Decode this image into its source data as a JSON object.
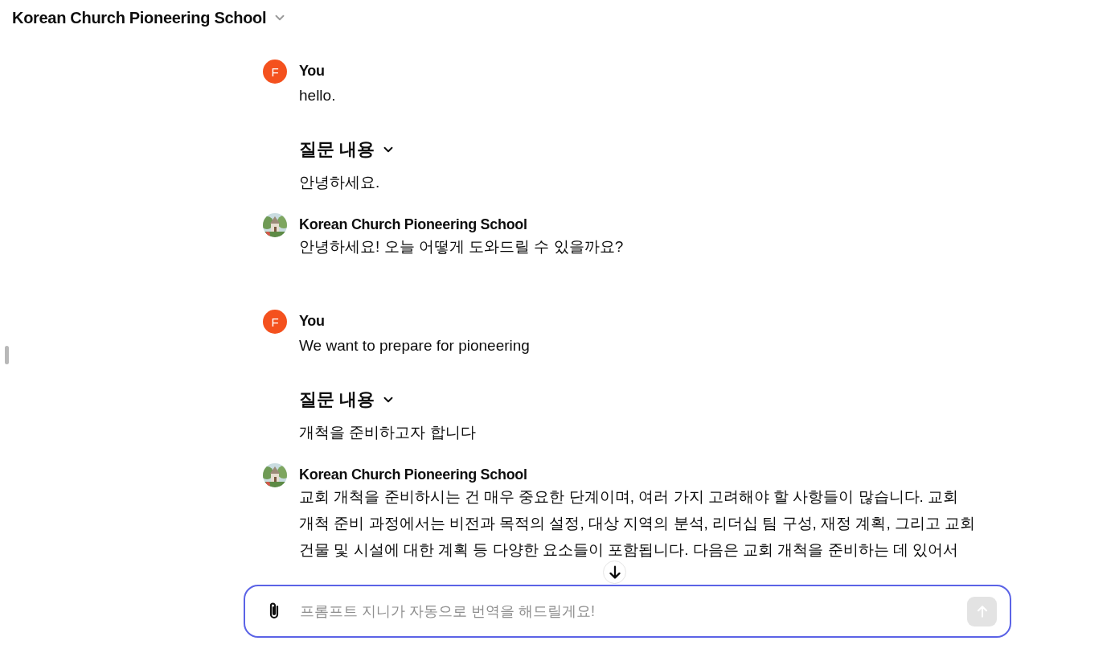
{
  "header": {
    "title": "Korean Church Pioneering School"
  },
  "messages": [
    {
      "kind": "user",
      "avatar_letter": "F",
      "author": "You",
      "text": "hello."
    },
    {
      "kind": "translation",
      "heading": "질문 내용",
      "text": "안녕하세요."
    },
    {
      "kind": "bot",
      "author": "Korean Church Pioneering School",
      "text": "안녕하세요! 오늘 어떻게 도와드릴 수 있을까요?"
    },
    {
      "kind": "user",
      "avatar_letter": "F",
      "author": "You",
      "text": "We want to prepare for pioneering"
    },
    {
      "kind": "translation",
      "heading": "질문 내용",
      "text": "개척을 준비하고자 합니다"
    },
    {
      "kind": "bot",
      "author": "Korean Church Pioneering School",
      "text": "교회 개척을 준비하시는 건 매우 중요한 단계이며, 여러 가지 고려해야 할 사항들이 많습니다. 교회 개척 준비 과정에서는 비전과 목적의 설정, 대상 지역의 분석, 리더십 팀 구성, 재정 계획, 그리고 교회 건물 및 시설에 대한 계획 등 다양한 요소들이 포함됩니다. 다음은 교회 개척을 준비하는 데 있어서"
    }
  ],
  "composer": {
    "placeholder": "프롬프트 지니가 자동으로 번역을 해드릴게요!"
  }
}
